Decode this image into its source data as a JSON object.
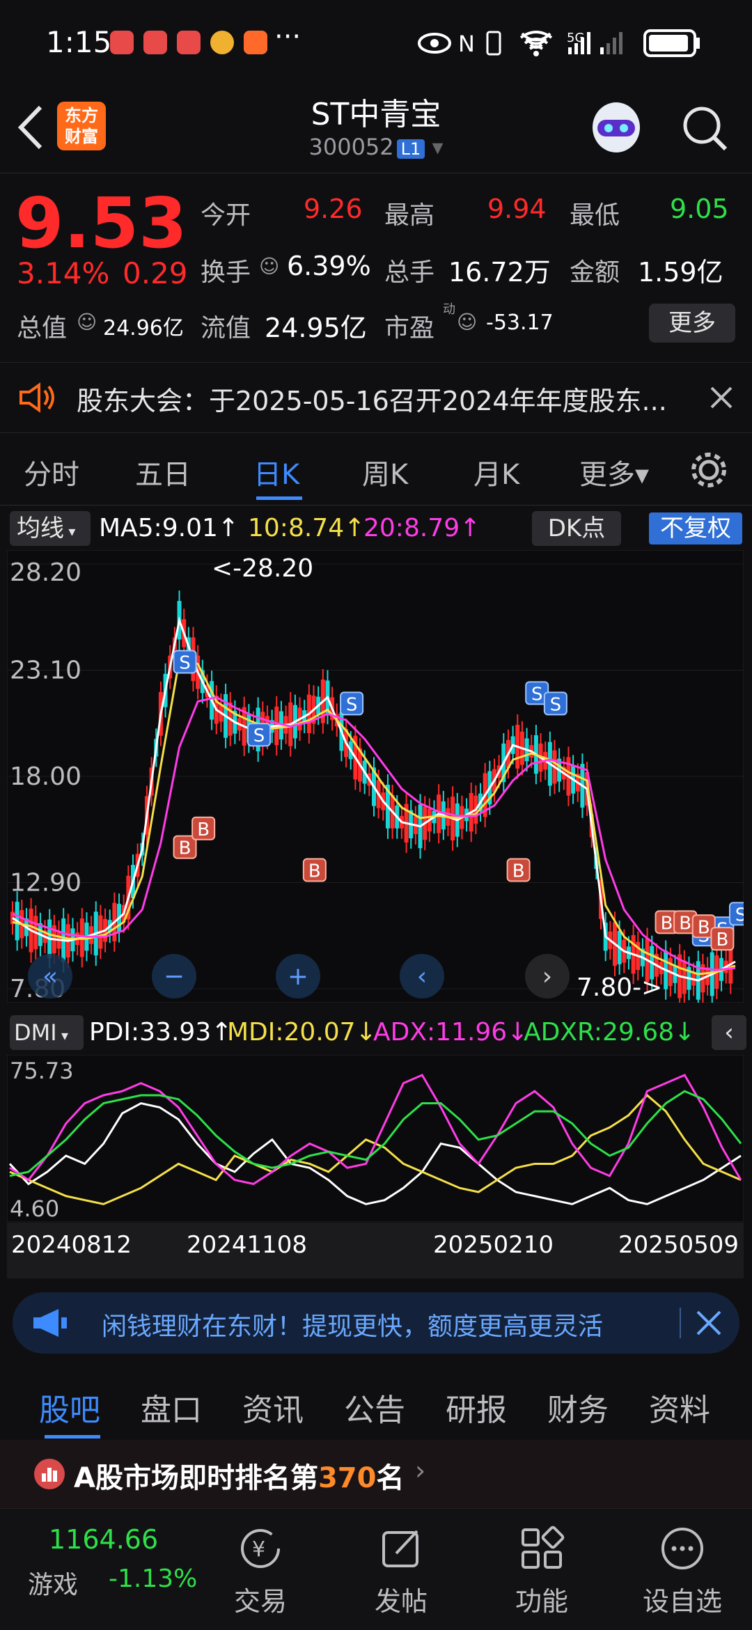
{
  "status": {
    "time": "1:15",
    "dots": "···",
    "signal": "5G"
  },
  "header": {
    "title": "ST中青宝",
    "code": "300052",
    "badge": "L1",
    "brand_line1": "东方",
    "brand_line2": "财富"
  },
  "quote": {
    "price": "9.53",
    "change_pct": "3.14%",
    "change": "0.29",
    "open_label": "今开",
    "open": "9.26",
    "high_label": "最高",
    "high": "9.94",
    "low_label": "最低",
    "low": "9.05",
    "turnover_label": "换手",
    "turnover": "6.39%",
    "volume_label": "总手",
    "volume": "16.72万",
    "amount_label": "金额",
    "amount": "1.59亿",
    "mktcap_label": "总值",
    "mktcap": "24.96亿",
    "float_label": "流值",
    "float": "24.95亿",
    "pe_label": "市盈",
    "pe_sup": "动",
    "pe": "-53.17",
    "more_button": "更多"
  },
  "notice": {
    "text": "股东大会：于2025-05-16召开2024年年度股东..."
  },
  "period_tabs": [
    {
      "label": "分时"
    },
    {
      "label": "五日"
    },
    {
      "label": "日K"
    },
    {
      "label": "周K"
    },
    {
      "label": "月K"
    },
    {
      "label": "更多▾"
    }
  ],
  "indicator_bar": {
    "selector": "均线",
    "ma5": "MA5:9.01↑",
    "ma10": "10:8.74↑",
    "ma20": "20:8.79↑",
    "dk": "DK点",
    "fq": "不复权"
  },
  "dmi_bar": {
    "selector": "DMI",
    "pdi": "PDI:33.93↑",
    "mdi": "MDI:20.07↓",
    "adx": "ADX:11.96↓",
    "adxr": "ADXR:29.68↓"
  },
  "chart_data": [
    {
      "type": "candlestick",
      "title": "",
      "ylim": [
        7.8,
        28.2
      ],
      "y_ticks": [
        "28.20",
        "23.10",
        "18.00",
        "12.90",
        "7.80"
      ],
      "annotations": {
        "max_label": "<-28.20",
        "min_label": "7.80->"
      },
      "markers": {
        "buy": "B",
        "sell": "S"
      },
      "ma_series": [
        {
          "name": "MA5",
          "color": "#ffffff",
          "values": [
            11.2,
            10.6,
            10.2,
            10.1,
            10.3,
            10.6,
            11.4,
            14.5,
            21.0,
            25.5,
            23.0,
            21.2,
            20.6,
            20.2,
            20.4,
            20.5,
            21.0,
            21.8,
            19.6,
            18.2,
            16.8,
            15.8,
            15.6,
            16.2,
            15.9,
            16.4,
            17.8,
            19.5,
            19.2,
            18.6,
            18.0,
            17.4,
            10.3,
            9.6,
            9.3,
            8.8,
            8.4,
            8.2,
            8.6,
            9.1
          ]
        },
        {
          "name": "MA10",
          "color": "#f5e04a",
          "values": [
            11.0,
            10.8,
            10.4,
            10.2,
            10.2,
            10.4,
            11.0,
            13.2,
            18.5,
            23.6,
            23.4,
            21.6,
            21.0,
            20.6,
            20.3,
            20.4,
            20.7,
            21.2,
            20.2,
            18.9,
            17.6,
            16.5,
            16.0,
            16.1,
            16.0,
            16.2,
            17.2,
            18.8,
            19.1,
            18.8,
            18.2,
            17.8,
            11.8,
            10.3,
            9.6,
            9.2,
            8.8,
            8.5,
            8.6,
            8.9
          ]
        },
        {
          "name": "MA20",
          "color": "#ff3ce6",
          "values": [
            11.4,
            11.0,
            10.7,
            10.4,
            10.3,
            10.3,
            10.6,
            11.6,
            14.8,
            19.4,
            21.6,
            21.8,
            21.3,
            20.9,
            20.6,
            20.4,
            20.6,
            21.0,
            20.7,
            19.8,
            18.6,
            17.4,
            16.7,
            16.3,
            16.1,
            16.1,
            16.6,
            17.8,
            18.6,
            18.8,
            18.6,
            18.3,
            14.0,
            11.6,
            10.4,
            9.7,
            9.2,
            8.8,
            8.7,
            8.8
          ]
        }
      ]
    },
    {
      "type": "line",
      "title": "",
      "ylim": [
        4.6,
        75.73
      ],
      "y_ticks": [
        "75.73",
        "4.60"
      ],
      "x_ticks": [
        "20240812",
        "20241108",
        "20250210",
        "20250509"
      ],
      "series": [
        {
          "name": "PDI",
          "color": "#ffffff",
          "values": [
            30,
            20,
            26,
            34,
            30,
            40,
            55,
            60,
            58,
            52,
            40,
            30,
            26,
            35,
            42,
            30,
            28,
            22,
            14,
            10,
            12,
            18,
            26,
            40,
            38,
            30,
            22,
            16,
            14,
            12,
            10,
            14,
            18,
            12,
            10,
            14,
            18,
            22,
            28,
            34
          ]
        },
        {
          "name": "MDI",
          "color": "#f5e04a",
          "values": [
            26,
            22,
            18,
            14,
            12,
            10,
            14,
            18,
            24,
            30,
            26,
            22,
            34,
            30,
            26,
            32,
            30,
            26,
            34,
            42,
            38,
            30,
            26,
            22,
            18,
            16,
            22,
            28,
            30,
            30,
            34,
            44,
            48,
            54,
            64,
            56,
            42,
            30,
            26,
            22
          ]
        },
        {
          "name": "ADX",
          "color": "#ff3ce6",
          "values": [
            28,
            22,
            34,
            50,
            60,
            64,
            66,
            70,
            66,
            58,
            44,
            30,
            22,
            20,
            26,
            34,
            40,
            36,
            28,
            30,
            50,
            70,
            74,
            58,
            40,
            30,
            44,
            60,
            66,
            58,
            40,
            28,
            24,
            40,
            66,
            70,
            74,
            58,
            38,
            22
          ]
        },
        {
          "name": "ADXR",
          "color": "#2ee04a",
          "values": [
            24,
            26,
            34,
            42,
            52,
            60,
            62,
            64,
            64,
            62,
            54,
            44,
            36,
            30,
            28,
            30,
            34,
            36,
            34,
            32,
            40,
            52,
            60,
            60,
            52,
            42,
            44,
            50,
            56,
            56,
            50,
            40,
            34,
            38,
            50,
            60,
            66,
            62,
            52,
            40
          ]
        }
      ]
    }
  ],
  "chart_controls": [
    "«",
    "−",
    "+",
    "‹",
    "›"
  ],
  "ad": {
    "text": "闲钱理财在东财！提现更快，额度更高更灵活"
  },
  "section_tabs": [
    {
      "label": "股吧"
    },
    {
      "label": "盘口"
    },
    {
      "label": "资讯"
    },
    {
      "label": "公告"
    },
    {
      "label": "研报"
    },
    {
      "label": "财务"
    },
    {
      "label": "资料"
    }
  ],
  "rank": {
    "prefix": "A股市场即时排名第",
    "num": "370",
    "suffix": "名"
  },
  "bottom_nav": {
    "index_value": "1164.66",
    "index_name": "游戏",
    "index_change": "-1.13%",
    "items": [
      {
        "label": "交易"
      },
      {
        "label": "发帖"
      },
      {
        "label": "功能"
      },
      {
        "label": "设自选"
      }
    ]
  }
}
